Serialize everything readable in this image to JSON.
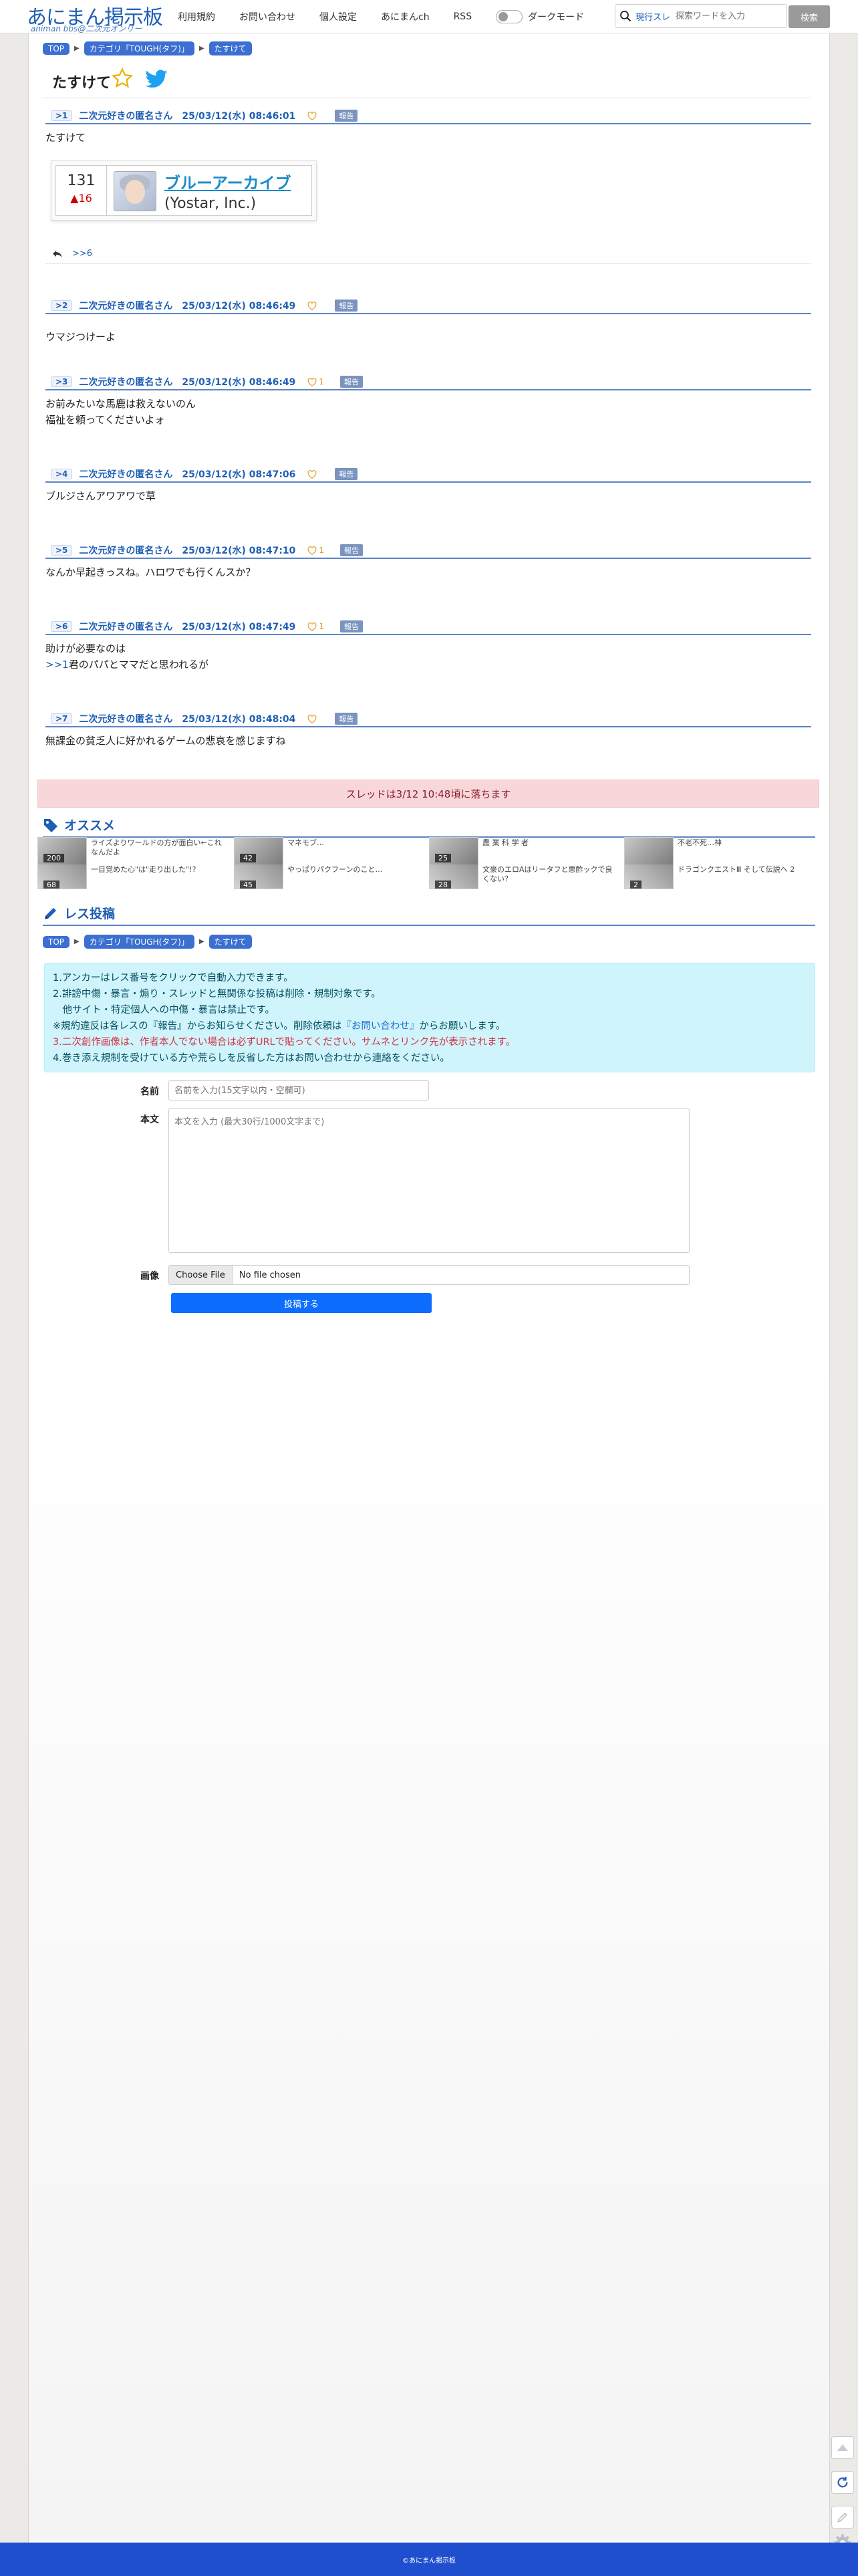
{
  "header": {
    "logo_main": "あにまん掲示板",
    "logo_sub": "animan bbs@二次元オンリー",
    "nav": [
      "利用規約",
      "お問い合わせ",
      "個人設定",
      "あにまんch",
      "RSS"
    ],
    "dark_mode_label": "ダークモード",
    "search_scope": "現行スレ",
    "search_placeholder": "探索ワードを入力",
    "search_button": "検索"
  },
  "breadcrumb": [
    "TOP",
    "カテゴリ「TOUGH(タフ)」",
    "たすけて"
  ],
  "thread": {
    "title": "たすけて"
  },
  "product": {
    "rank": "131",
    "change": "▲16",
    "title": "ブルーアーカイブ",
    "maker": "(Yostar, Inc.)"
  },
  "reply_link": ">>6",
  "report_label": "報告",
  "posts": [
    {
      "num": "1",
      "name": "二次元好きの匿名さん",
      "date": "25/03/12(水) 08:46:01",
      "likes": "",
      "body": [
        "たすけて"
      ]
    },
    {
      "num": "2",
      "name": "二次元好きの匿名さん",
      "date": "25/03/12(水) 08:46:49",
      "likes": "",
      "body": [
        "ウマジつけーよ"
      ]
    },
    {
      "num": "3",
      "name": "二次元好きの匿名さん",
      "date": "25/03/12(水) 08:46:49",
      "likes": "1",
      "body": [
        "お前みたいな馬鹿は救えないのん",
        "福祉を頼ってくださいよォ"
      ]
    },
    {
      "num": "4",
      "name": "二次元好きの匿名さん",
      "date": "25/03/12(水) 08:47:06",
      "likes": "",
      "body": [
        "ブルジさんアワアワで草"
      ]
    },
    {
      "num": "5",
      "name": "二次元好きの匿名さん",
      "date": "25/03/12(水) 08:47:10",
      "likes": "1",
      "body": [
        "なんか早起きっスね。ハロワでも行くんスか？"
      ]
    },
    {
      "num": "6",
      "name": "二次元好きの匿名さん",
      "date": "25/03/12(水) 08:47:49",
      "likes": "1",
      "body": [
        "助けが必要なのは"
      ],
      "anchor": ">>1",
      "anchor_tail": "君のパパとママだと思われるが"
    },
    {
      "num": "7",
      "name": "二次元好きの匿名さん",
      "date": "25/03/12(水) 08:48:04",
      "likes": "",
      "body": [
        "無課金の貧乏人に好かれるゲームの悲哀を感じますね"
      ]
    }
  ],
  "drop_notice": "スレッドは3/12 10:48頃に落ちます",
  "recommend": {
    "title": "オススメ",
    "items": [
      {
        "count1": "200",
        "t1": "ライズよりワールドの方が面白い←これなんだよ",
        "count2": "68",
        "t2": "一目覚めた心\"は\"走り出した\"!?"
      },
      {
        "count1": "42",
        "t1": "マネモブ…",
        "count2": "45",
        "t2": "やっぱりパクフーンのこと…"
      },
      {
        "count1": "25",
        "t1": "農 業 科 学 者",
        "count2": "28",
        "t2": "文豪のエロAはリータフと悪酢ックで良くない？"
      },
      {
        "count1": "",
        "t1": "不老不死…神",
        "count2": "2",
        "t2": "ドラゴンクエストⅢ そして伝説へ 2"
      }
    ]
  },
  "reply_form": {
    "title": "レス投稿",
    "rules": [
      "1.アンカーはレス番号をクリックで自動入力できます。",
      "2.誹謗中傷・暴言・煽り・スレッドと無関係な投稿は削除・規制対象です。",
      "　他サイト・特定個人への中傷・暴言は禁止です。",
      "※規約違反は各レスの『報告』からお知らせください。削除依頼は",
      "『お問い合わせ』",
      "からお願いします。",
      "3.二次創作画像は、作者本人でない場合は必ずURLで貼ってください。サムネとリンク先が表示されます。",
      "4.巻き添え規制を受けている方や荒らしを反省した方はお問い合わせから連絡をください。"
    ],
    "name_label": "名前",
    "name_placeholder": "名前を入力(15文字以内・空欄可)",
    "body_label": "本文",
    "body_placeholder": "本文を入力 (最大30行/1000文字まで)",
    "image_label": "画像",
    "file_button": "Choose File",
    "file_status": "No file chosen",
    "submit": "投稿する"
  },
  "footer": "©あにまん掲示板",
  "colors": {
    "accent": "#1f5fb4",
    "footer": "#1f4fcf",
    "notice_bg": "#cff4fc",
    "drop_bg": "#f8d7da"
  }
}
